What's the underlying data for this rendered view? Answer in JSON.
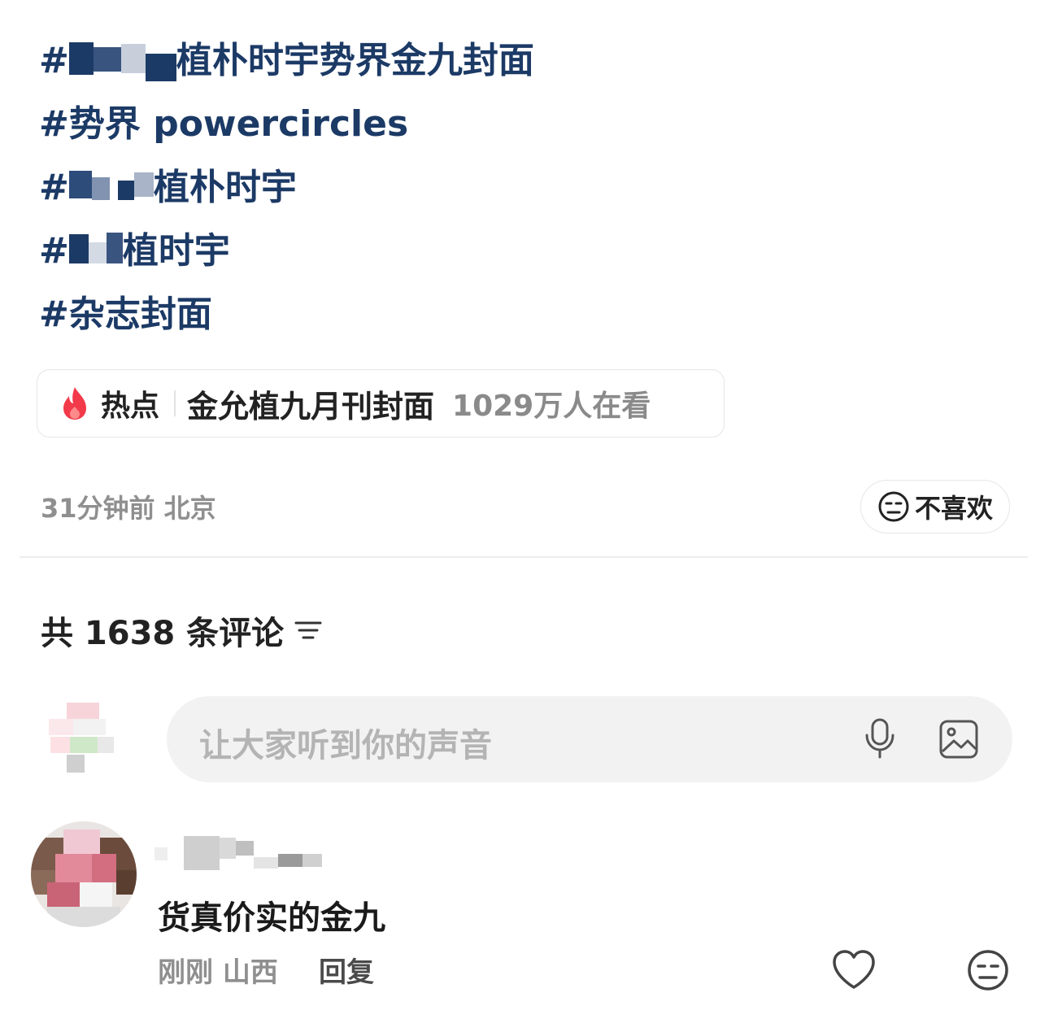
{
  "post": {
    "hashtags": [
      {
        "prefix": "#",
        "text": "植朴时宇势界金九封面"
      },
      {
        "prefix": "#",
        "text": "势界 powercircles"
      },
      {
        "prefix": "#",
        "text": "植朴时宇"
      },
      {
        "prefix": "#",
        "text": "植时宇"
      },
      {
        "prefix": "#",
        "text": "杂志封面"
      }
    ],
    "hot_topic": {
      "label": "热点",
      "title": "金允植九月刊封面",
      "viewers": "1029万人在看",
      "icon": "fire-icon",
      "accent": "#f23a4a"
    },
    "meta": "31分钟前 北京",
    "dislike_label": "不喜欢"
  },
  "comments": {
    "header": "共 1638 条评论",
    "input_placeholder": "让大家听到你的声音",
    "list": [
      {
        "text": "货真价实的金九",
        "time_location": "刚刚 山西",
        "reply_label": "回复"
      }
    ]
  },
  "colors": {
    "hashtag": "#1c3a66",
    "muted": "#8f8f8f",
    "input_bg": "#f2f2f2"
  }
}
